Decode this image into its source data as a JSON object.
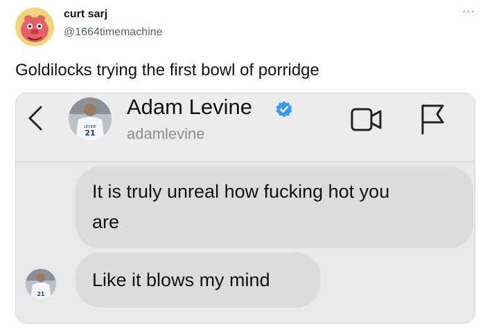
{
  "tweet": {
    "author": {
      "name": "curt sarj",
      "handle": "@1664timemachine",
      "avatar_icon": "cartoon-face-avatar"
    },
    "more_label": "···",
    "text": "Goldilocks trying the first bowl of porridge"
  },
  "dm": {
    "header": {
      "name": "Adam Levine",
      "handle": "adamlevine",
      "avatar_icon": "jersey-photo-avatar",
      "jersey_number": "21",
      "jersey_lettering": "LEVINE",
      "verified_color": "#3897f0",
      "icons": [
        "back-chevron-icon",
        "verified-badge-icon",
        "video-call-icon",
        "flag-icon"
      ]
    },
    "messages": [
      {
        "text_line1": "It is truly unreal how fucking hot you",
        "text_line2": "are"
      },
      {
        "text": "Like it blows my mind"
      }
    ],
    "colors": {
      "bubble": "#dcdcdd",
      "background": "#e9e9ea"
    }
  }
}
